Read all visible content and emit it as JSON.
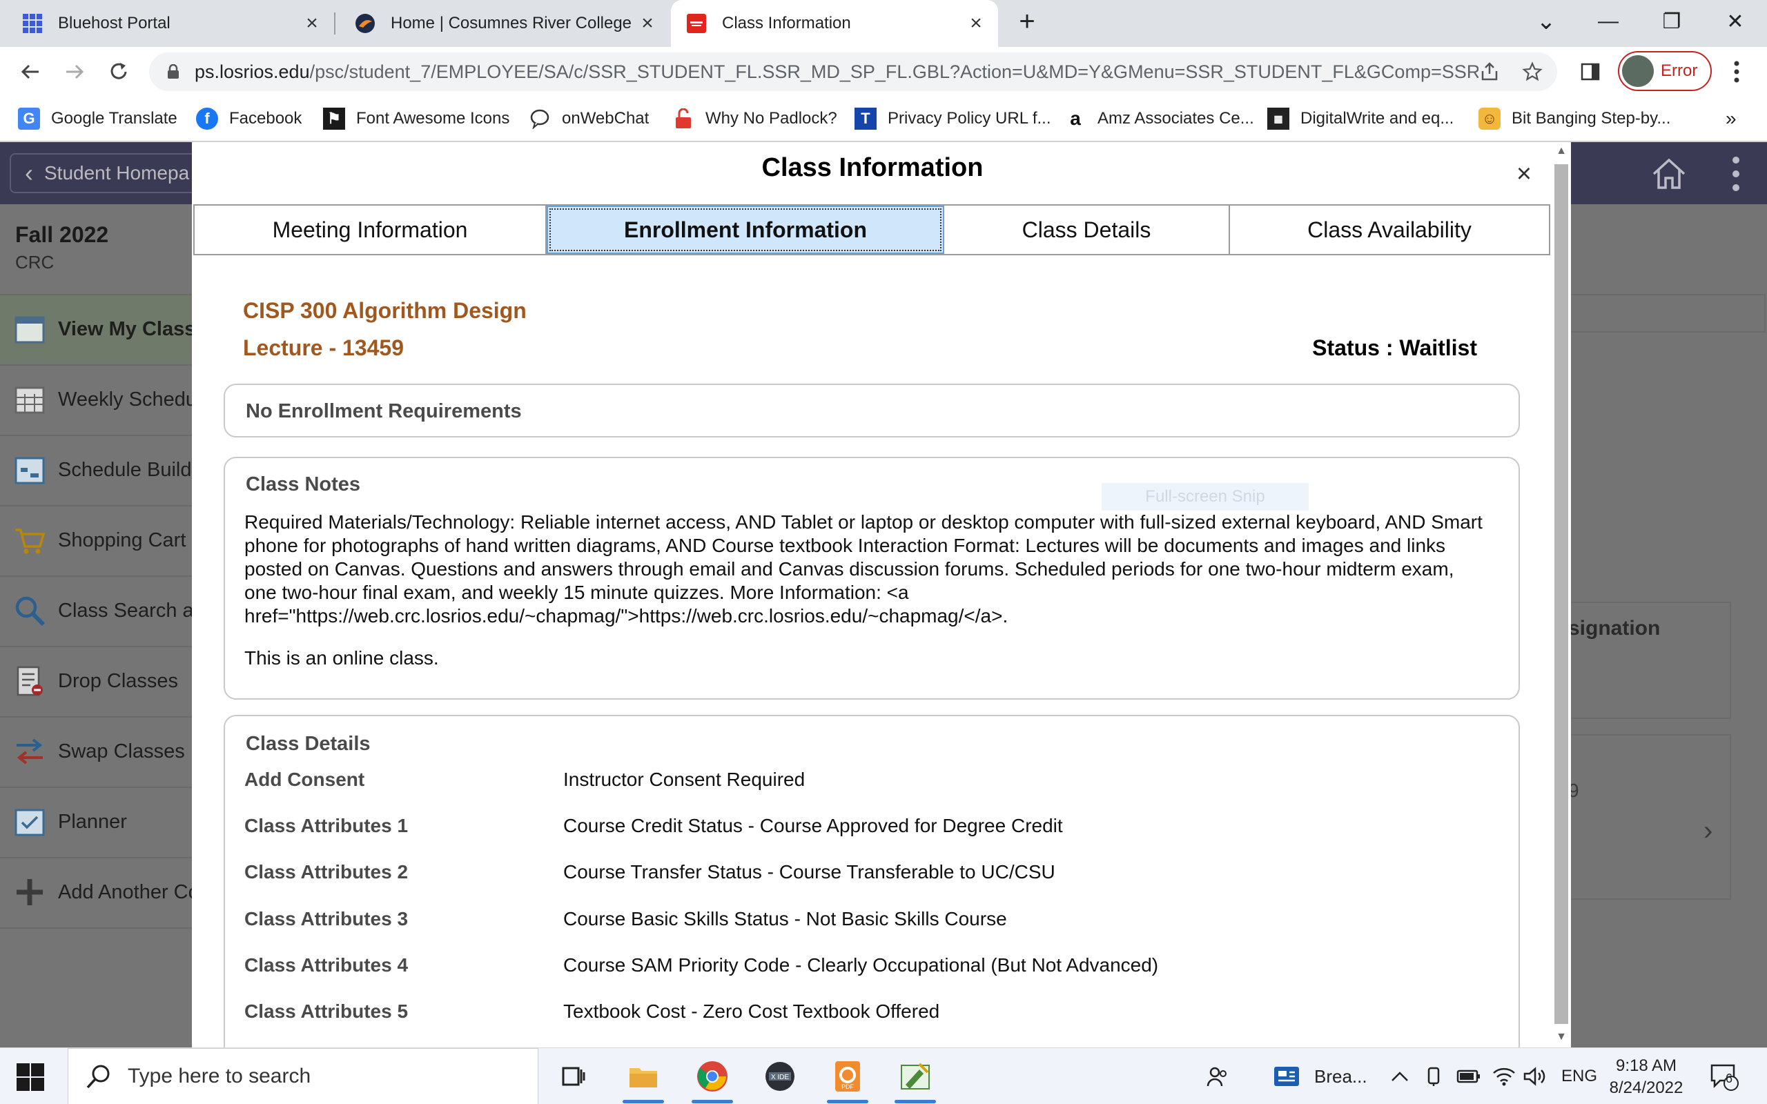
{
  "browser": {
    "tabs": [
      {
        "title": "Bluehost Portal",
        "icon": "grid-icon",
        "close": "×"
      },
      {
        "title": "Home | Cosumnes River College",
        "icon": "college-icon",
        "close": "×"
      },
      {
        "title": "Class Information",
        "icon": "oracle-icon",
        "close": "×"
      }
    ],
    "new_tab": "+",
    "window_controls": {
      "tab_search": "⌄",
      "minimize": "—",
      "restore": "❐",
      "close": "✕"
    },
    "url_host": "ps.losrios.edu",
    "url_path": "/psc/student_7/EMPLOYEE/SA/c/SSR_STUDENT_FL.SSR_MD_SP_FL.GBL?Action=U&MD=Y&GMenu=SSR_STUDENT_FL&GComp=SSR_S...",
    "profile_label": "Error",
    "bookmarks": [
      {
        "label": "Google Translate",
        "icon": "translate-icon"
      },
      {
        "label": "Facebook",
        "icon": "facebook-icon"
      },
      {
        "label": "Font Awesome Icons",
        "icon": "flag-icon"
      },
      {
        "label": "onWebChat",
        "icon": "chat-bubble-icon"
      },
      {
        "label": "Why No Padlock?",
        "icon": "padlock-icon"
      },
      {
        "label": "Privacy Policy URL f...",
        "icon": "t-icon"
      },
      {
        "label": "Amz Associates Ce...",
        "icon": "amazon-icon"
      },
      {
        "label": "DigitalWrite and eq...",
        "icon": "chip-icon"
      },
      {
        "label": "Bit Banging Step-by...",
        "icon": "person-icon"
      }
    ],
    "bookmarks_more": "»"
  },
  "page": {
    "back_label": "Student Homepa",
    "term": {
      "name": "Fall 2022",
      "campus": "CRC"
    },
    "sidebar": [
      {
        "label": "View My Class"
      },
      {
        "label": "Weekly Schedu"
      },
      {
        "label": "Schedule Build"
      },
      {
        "label": "Shopping Cart"
      },
      {
        "label": "Class Search a"
      },
      {
        "label": "Drop Classes"
      },
      {
        "label": "Swap Classes"
      },
      {
        "label": "Planner"
      },
      {
        "label": "Add Another Co"
      }
    ],
    "bg_right": {
      "col_header": "signation",
      "value": "9",
      "chevron": "›"
    }
  },
  "modal": {
    "title": "Class Information",
    "close": "×",
    "tabs": [
      "Meeting Information",
      "Enrollment Information",
      "Class Details",
      "Class Availability"
    ],
    "course_name": "CISP 300 Algorithm Design",
    "section": "Lecture - 13459",
    "status": "Status : Waitlist",
    "requirements": "No Enrollment Requirements",
    "notes_header": "Class Notes",
    "notes_text": "Required Materials/Technology: Reliable internet access, AND Tablet or laptop or desktop computer with full-sized external keyboard, AND Smart phone for photographs of hand written diagrams, AND Course textbook Interaction Format: Lectures will be documents and images and links posted on Canvas. Questions and answers through email and Canvas discussion forums. Scheduled periods for one two-hour midterm exam, one two-hour final exam, and weekly 15 minute quizzes. More Information: <a href=\"https://web.crc.losrios.edu/~chapmag/\">https://web.crc.losrios.edu/~chapmag/</a>.",
    "notes_online": "This is an online class.",
    "snip_ghost": "Full-screen Snip",
    "details_header": "Class Details",
    "details": [
      {
        "label": "Add Consent",
        "value": "Instructor Consent Required"
      },
      {
        "label": "Class Attributes 1",
        "value": "Course Credit Status - Course Approved for Degree Credit"
      },
      {
        "label": "Class Attributes 2",
        "value": "Course Transfer Status - Course Transferable to UC/CSU"
      },
      {
        "label": "Class Attributes 3",
        "value": "Course Basic Skills Status - Not Basic Skills Course"
      },
      {
        "label": "Class Attributes 4",
        "value": "Course SAM Priority Code - Clearly Occupational (But Not Advanced)"
      },
      {
        "label": "Class Attributes 5",
        "value": "Textbook Cost - Zero Cost Textbook Offered"
      }
    ]
  },
  "taskbar": {
    "search_placeholder": "Type here to search",
    "news_label": "Brea...",
    "lang": "ENG",
    "time": "9:18 AM",
    "date": "8/24/2022",
    "notification_count": "6"
  },
  "colors": {
    "accent_course": "#a0581e",
    "tab_selected": "#cfe6fb",
    "header_bar": "#3a3a54",
    "profile_error": "#c5221f"
  }
}
